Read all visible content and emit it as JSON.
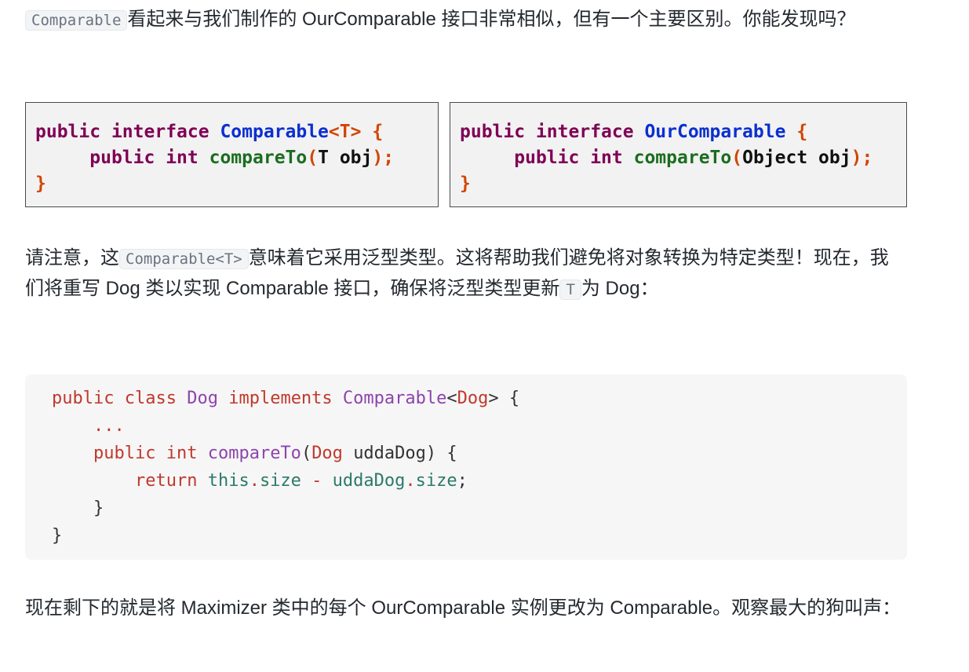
{
  "intro": {
    "code": "Comparable",
    "text": "看起来与我们制作的 OurComparable 接口非常相似，但有一个主要区别。你能发现吗？"
  },
  "snippet_left": {
    "kw_public": "public",
    "kw_interface": "interface",
    "type_name": "Comparable",
    "generic": "<T>",
    "brace_open": "{",
    "kw_public2": "public",
    "kw_int": "int",
    "method": "compareTo",
    "paren_open": "(",
    "param_type": "T",
    "param_name": "obj",
    "paren_close": ");",
    "brace_close": "}"
  },
  "snippet_right": {
    "kw_public": "public",
    "kw_interface": "interface",
    "type_name": "OurComparable",
    "brace_open": "{",
    "kw_public2": "public",
    "kw_int": "int",
    "method": "compareTo",
    "paren_open": "(",
    "param_type": "Object",
    "param_name": "obj",
    "paren_close": ");",
    "brace_close": "}"
  },
  "note": {
    "before": "请注意，这",
    "code": "Comparable<T>",
    "after1": "意味着它采用泛型类型。这将帮助我们避免将对象转换为特定类型！现在，我们将重写 Dog 类以实现 Comparable 接口，确保将泛型类型更新",
    "code2": "T",
    "after2": "为 Dog："
  },
  "code": {
    "l1_public": "public",
    "l1_class": "class",
    "l1_dog": "Dog",
    "l1_impl": "implements",
    "l1_comp": "Comparable",
    "l1_lt": "<",
    "l1_dog2": "Dog",
    "l1_gt": ">",
    "l1_brace": "{",
    "l2_dots": "...",
    "l3_public": "public",
    "l3_int": "int",
    "l3_method": "compareTo",
    "l3_paren": "(",
    "l3_dog": "Dog",
    "l3_param": "uddaDog) {",
    "l4_return": "return",
    "l4_this": "this",
    "l4_dot": ".",
    "l4_size": "size",
    "l4_minus": "-",
    "l4_udda": "uddaDog",
    "l4_dot2": ".",
    "l4_size2": "size",
    "l4_semi": ";",
    "l5_brace": "}",
    "l6_brace": "}"
  },
  "outro": {
    "text": "现在剩下的就是将 Maximizer 类中的每个 OurComparable 实例更改为 Comparable。观察最大的狗叫声："
  }
}
